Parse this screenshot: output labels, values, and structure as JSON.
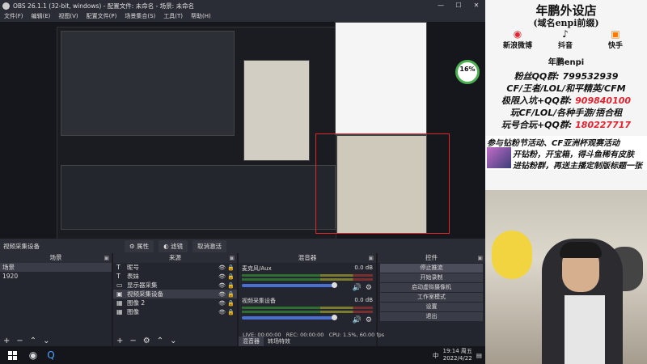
{
  "window": {
    "title": "OBS 26.1.1 (32-bit, windows) - 配置文件: 未命名 - 场景: 未命名",
    "minimize": "—",
    "maximize": "☐",
    "close": "✕"
  },
  "menu": [
    "文件(F)",
    "编辑(E)",
    "视图(V)",
    "配置文件(P)",
    "场景集合(S)",
    "工具(T)",
    "帮助(H)"
  ],
  "source_toolbar": {
    "label": "视频采集设备",
    "properties": "属性",
    "filters": "滤镜",
    "deactivate": "取消激活"
  },
  "scenes": {
    "header": "场景",
    "items": [
      "场景",
      "1920"
    ]
  },
  "sources": {
    "header": "来源",
    "items": [
      {
        "icon": "T",
        "name": "昵号"
      },
      {
        "icon": "T",
        "name": "表妹"
      },
      {
        "icon": "▭",
        "name": "显示器采集"
      },
      {
        "icon": "▣",
        "name": "视频采集设备"
      },
      {
        "icon": "▦",
        "name": "图像 2"
      },
      {
        "icon": "▦",
        "name": "图像"
      }
    ]
  },
  "mixer": {
    "header": "混音器",
    "channels": [
      {
        "name": "麦克风/Aux",
        "db": "0.0 dB"
      },
      {
        "name": "视频采集设备",
        "db": "0.0 dB"
      }
    ],
    "tabs": [
      "混音器",
      "转场特效"
    ]
  },
  "controls": {
    "header": "控件",
    "buttons": [
      "停止推流",
      "开始录制",
      "启动虚拟摄像机",
      "工作室模式",
      "设置",
      "退出"
    ]
  },
  "status": {
    "live": "LIVE: 00:00:00",
    "rec": "REC: 00:00:00",
    "cpu": "CPU: 1.5%, 60.00 fps"
  },
  "taskbar": {
    "ime": "中",
    "time": "19:14 周五",
    "date": "2022/4/22"
  },
  "overlay": {
    "title": "年鹏外设店",
    "subtitle": "(域名enpi前缀)",
    "socials": [
      "新浪微博",
      "抖音",
      "快手"
    ],
    "group_label": "年鹏enpi",
    "fan_qq": "粉丝QQ群: 799532939",
    "games": "CF/王者/LOL/和平精英/CFM",
    "fast_group": "极限入坑+QQ群:",
    "fast_group_num": "909840100",
    "play_line": "玩CF/LOL/各种手游/捂合租",
    "duo_group": "玩号合玩+QQ群:",
    "duo_group_num": "180227717",
    "promo_line1": "参与钻粉节活动、CF亚洲杯观赛活动",
    "promo_line2": "开钻粉，开宝箱，得斗鱼稀有皮肤",
    "promo_line3": "进钻粉群，再送主播定制版标题一张"
  },
  "stats": {
    "percent": "16%",
    "rate": "1.5%"
  }
}
